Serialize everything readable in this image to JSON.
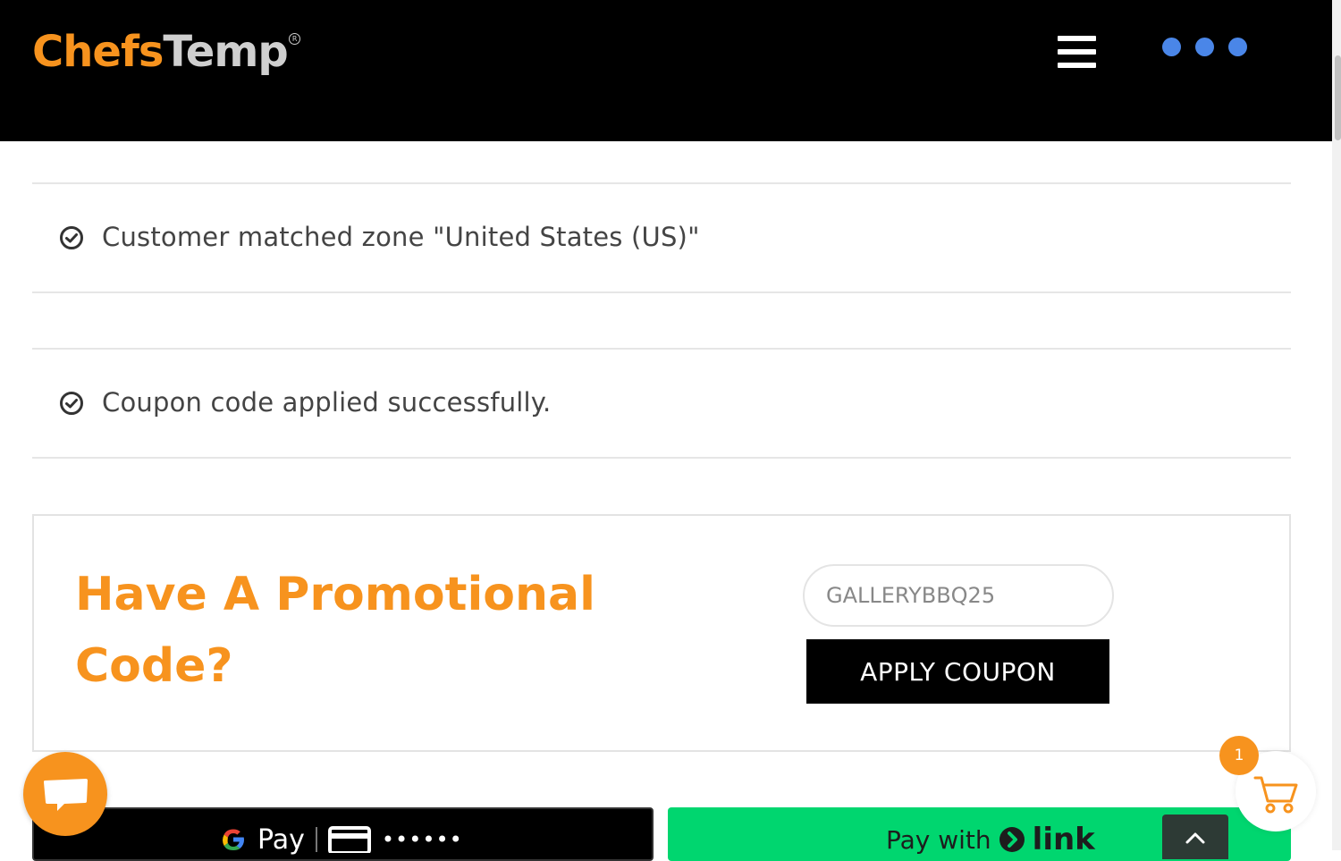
{
  "header": {
    "logo_part1": "Chefs",
    "logo_part2": "Temp",
    "logo_reg": "R",
    "menu_icon": "hamburger-icon",
    "more_icon": "three-dots-icon"
  },
  "notices": [
    {
      "icon": "check-circle-icon",
      "text": "Customer matched zone \"United States (US)\""
    },
    {
      "icon": "check-circle-icon",
      "text": "Coupon code applied successfully."
    }
  ],
  "promo": {
    "title": "Have A Promotional Code?",
    "coupon_value": "GALLERYBBQ25",
    "apply_label": "APPLY COUPON"
  },
  "payments": {
    "gpay_label": "Pay",
    "gpay_card_dots": "••••••",
    "link_prefix": "Pay with",
    "link_word": "link"
  },
  "cart": {
    "count": "1"
  },
  "colors": {
    "brand_orange": "#f7931e",
    "header_bg": "#000000",
    "dots_blue": "#4a86e8",
    "link_green": "#00d66f"
  }
}
